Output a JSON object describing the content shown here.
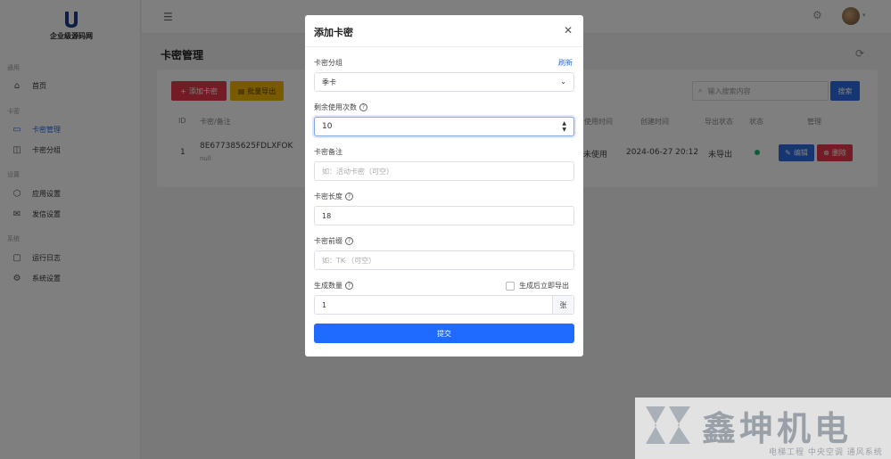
{
  "app": {
    "brand": "企业级源码网"
  },
  "sidebar": {
    "groups": [
      "通用",
      "卡密",
      "设置",
      "系统"
    ],
    "items": [
      {
        "label": "首页",
        "icon": "home-icon"
      },
      {
        "label": "卡密管理",
        "icon": "card-icon"
      },
      {
        "label": "卡密分组",
        "icon": "folder-icon"
      },
      {
        "label": "应用设置",
        "icon": "cube-icon"
      },
      {
        "label": "发信设置",
        "icon": "mail-icon"
      },
      {
        "label": "运行日志",
        "icon": "log-icon"
      },
      {
        "label": "系统设置",
        "icon": "gear-icon"
      }
    ]
  },
  "page": {
    "title": "卡密管理",
    "add_button": "添加卡密",
    "export_button": "批量导出",
    "search_placeholder": "输入搜索内容",
    "search_button": "搜索"
  },
  "table": {
    "headers": [
      "ID",
      "卡密/备注",
      "使用时间",
      "创建时间",
      "导出状态",
      "状态",
      "管理"
    ],
    "row": {
      "id": "1",
      "card": "8E677385625FDLXFOK",
      "note": "null",
      "usage": "未使用",
      "created": "2024-06-27 20:12",
      "export_status": "未导出",
      "edit": "编辑",
      "delete": "删除"
    }
  },
  "modal": {
    "title": "添加卡密",
    "group_label": "卡密分组",
    "refresh_link": "刷新",
    "group_value": "季卡",
    "uses_label": "剩余使用次数",
    "uses_value": "10",
    "note_label": "卡密备注",
    "note_placeholder": "如：活动卡密（可空）",
    "length_label": "卡密长度",
    "length_value": "18",
    "prefix_label": "卡密前缀",
    "prefix_placeholder": "如：TK-（可空）",
    "qty_label": "生成数量",
    "export_checkbox": "生成后立即导出",
    "qty_value": "1",
    "qty_unit": "张",
    "submit": "提交"
  },
  "watermark": {
    "title": "鑫坤机电",
    "subtitle": "电梯工程  中央空调  通风系统"
  },
  "colors": {
    "primary": "#2b6de6",
    "danger": "#e6394a",
    "warning": "#f0b400",
    "success": "#22b573"
  }
}
